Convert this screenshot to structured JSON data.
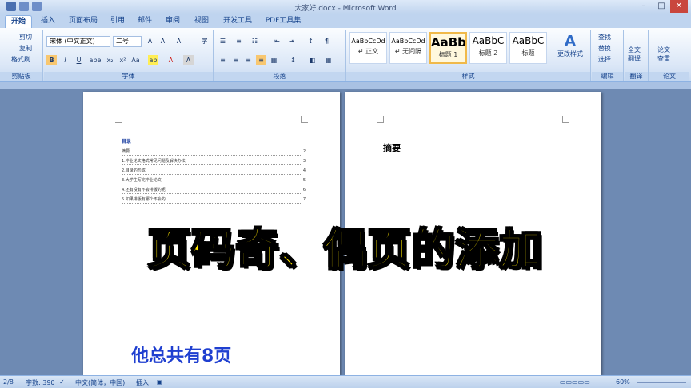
{
  "window": {
    "title": "大家好.docx - Microsoft Word",
    "min": "–",
    "max": "□",
    "close": "✕"
  },
  "tabs": [
    "开始",
    "插入",
    "页面布局",
    "引用",
    "邮件",
    "审阅",
    "视图",
    "开发工具",
    "PDF工具集"
  ],
  "clipboard": {
    "cut": "剪切",
    "copy": "复制",
    "format_painter": "格式刷",
    "label": "剪贴板"
  },
  "font": {
    "name": "宋体 (中文正文)",
    "size": "二号",
    "label": "字体",
    "grow": "A",
    "shrink": "A",
    "clear": "A",
    "bold": "B",
    "italic": "I",
    "underline": "U",
    "strike": "abe",
    "sub": "x₂",
    "sup": "x²",
    "case": "Aa",
    "highlight": "ab",
    "color": "A",
    "char_shade": "A",
    "enclose": "字"
  },
  "paragraph": {
    "label": "段落"
  },
  "styles": {
    "label": "样式",
    "items": [
      {
        "preview": "AaBbCcDd",
        "name": "↵ 正文"
      },
      {
        "preview": "AaBbCcDd",
        "name": "↵ 无间隔"
      },
      {
        "preview": "AaBb",
        "name": "标题 1"
      },
      {
        "preview": "AaBbC",
        "name": "标题 2"
      },
      {
        "preview": "AaBbC",
        "name": "标题"
      }
    ],
    "change": "更改样式"
  },
  "editing": {
    "find": "查找",
    "replace": "替换",
    "select": "选择",
    "label": "编辑"
  },
  "translate": {
    "btn": "全文\n翻译",
    "label": "翻译"
  },
  "paper": {
    "btn": "论文\n查重",
    "label": "论文"
  },
  "page1": {
    "toc_title": "目录",
    "toc": [
      {
        "text": "摘要",
        "page": "2"
      },
      {
        "text": "1.毕业论文格式常见问题及解决办法",
        "page": "3"
      },
      {
        "text": "2.目录的形成",
        "page": "4"
      },
      {
        "text": "3.大学生写完毕业论文",
        "page": "5"
      },
      {
        "text": "4.还有没有不会排版的呢",
        "page": "6"
      },
      {
        "text": "5.如果排版有哪个不会的",
        "page": "7"
      }
    ]
  },
  "page2": {
    "heading": "摘要"
  },
  "overlay": {
    "title": "页码奇、偶页的添加",
    "caption": "他总共有8页"
  },
  "status": {
    "page": "2/8",
    "words": "字数: 390",
    "lang": "中文(简体，中国)",
    "mode": "插入",
    "zoom": "60%"
  }
}
